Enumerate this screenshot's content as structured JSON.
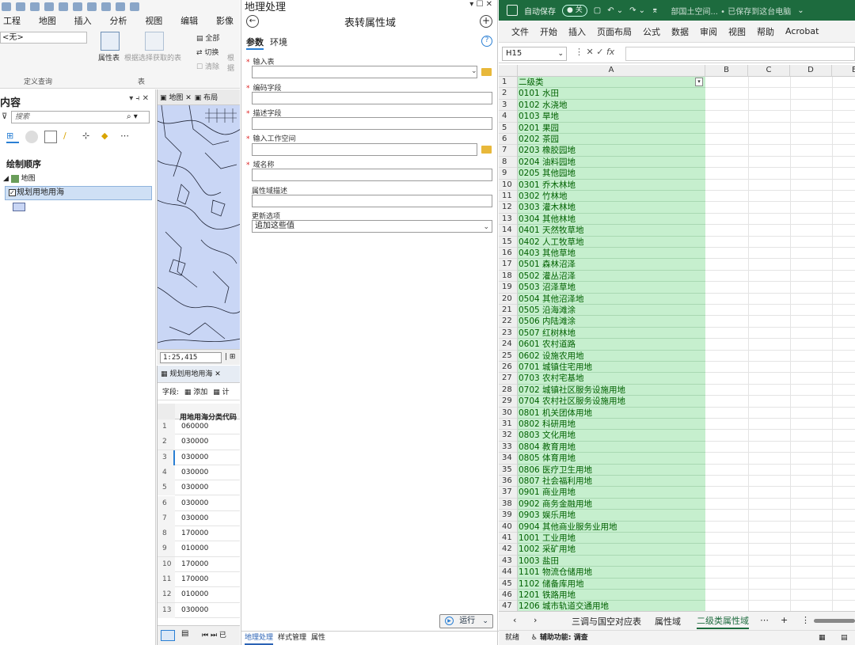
{
  "arcgis": {
    "ribbon_tabs": [
      "工程",
      "地图",
      "插入",
      "分析",
      "视图",
      "编辑",
      "影像"
    ],
    "definition_query_value": "<无>",
    "group_labels": {
      "definition_query": "定义查询",
      "table": "表"
    },
    "buttons": {
      "attribute_table": "属性表",
      "table_from_selection": "根据选择获取的表",
      "all": "全部",
      "switch": "切换",
      "clear": "清除",
      "basis": "根据"
    },
    "contents": {
      "title": "内容",
      "search_placeholder": "搜索",
      "draw_order": "绘制顺序",
      "map_item": "地图",
      "layer_item": "规划用地用海"
    },
    "map_tabs": [
      "地图",
      "布局"
    ],
    "scale": "1:25,415",
    "attribute_table": {
      "tab": "规划用地用海",
      "field_label": "字段:",
      "add_label": "添加",
      "calc_label": "计",
      "column_header": "用地用海分类代码",
      "rows": [
        {
          "n": "1",
          "v": "060000"
        },
        {
          "n": "2",
          "v": "030000"
        },
        {
          "n": "3",
          "v": "030000"
        },
        {
          "n": "4",
          "v": "030000"
        },
        {
          "n": "5",
          "v": "030000"
        },
        {
          "n": "6",
          "v": "030000"
        },
        {
          "n": "7",
          "v": "030000"
        },
        {
          "n": "8",
          "v": "170000"
        },
        {
          "n": "9",
          "v": "010000"
        },
        {
          "n": "10",
          "v": "170000"
        },
        {
          "n": "11",
          "v": "170000"
        },
        {
          "n": "12",
          "v": "010000"
        },
        {
          "n": "13",
          "v": "030000"
        }
      ]
    }
  },
  "geoprocessing": {
    "pane_title": "地理处理",
    "tool_title": "表转属性域",
    "tabs": [
      "参数",
      "环境"
    ],
    "params": [
      {
        "label": "输入表",
        "required": true,
        "value": ""
      },
      {
        "label": "编码字段",
        "required": true,
        "value": ""
      },
      {
        "label": "描述字段",
        "required": true,
        "value": ""
      },
      {
        "label": "输入工作空间",
        "required": true,
        "value": ""
      },
      {
        "label": "域名称",
        "required": true,
        "value": ""
      },
      {
        "label": "属性域描述",
        "required": false,
        "value": ""
      },
      {
        "label": "更新选项",
        "required": false,
        "value": "追加这些值"
      }
    ],
    "run_label": "运行",
    "footer_tabs": [
      "地理处理",
      "样式管理",
      "属性"
    ]
  },
  "excel": {
    "title_bar": {
      "autosave": "自动保存",
      "toggle": "关",
      "doc": "部国土空间...  •  已保存到这台电脑"
    },
    "menu": [
      "文件",
      "开始",
      "插入",
      "页面布局",
      "公式",
      "数据",
      "审阅",
      "视图",
      "帮助",
      "Acrobat"
    ],
    "name_box": "H15",
    "fx": "fx",
    "columns": [
      "A",
      "B",
      "C",
      "D",
      "E"
    ],
    "rows": [
      "二级类",
      "0101 水田",
      "0102 水浇地",
      "0103 旱地",
      "0201 果园",
      "0202 茶园",
      "0203 橡胶园地",
      "0204 油料园地",
      "0205 其他园地",
      "0301 乔木林地",
      "0302 竹林地",
      "0303 灌木林地",
      "0304 其他林地",
      "0401 天然牧草地",
      "0402 人工牧草地",
      "0403 其他草地",
      "0501 森林沼泽",
      "0502 灌丛沼泽",
      "0503 沼泽草地",
      "0504 其他沼泽地",
      "0505 沿海滩涂",
      "0506 内陆滩涂",
      "0507 红树林地",
      "0601 农村道路",
      "0602 设施农用地",
      "0701 城镇住宅用地",
      "0703 农村宅基地",
      "0702 城镇社区服务设施用地",
      "0704 农村社区服务设施用地",
      "0801 机关团体用地",
      "0802 科研用地",
      "0803 文化用地",
      "0804 教育用地",
      "0805 体育用地",
      "0806 医疗卫生用地",
      "0807 社会福利用地",
      "0901 商业用地",
      "0902 商务金融用地",
      "0903 娱乐用地",
      "0904 其他商业服务业用地",
      "1001 工业用地",
      "1002 采矿用地",
      "1003 盐田",
      "1101 物流仓储用地",
      "1102 储备库用地",
      "1201 铁路用地",
      "1206 城市轨道交通用地"
    ],
    "sheet_tabs": [
      "三调与国空对应表",
      "属性域",
      "二级类属性域"
    ],
    "status": {
      "ready": "就绪",
      "accessibility": "辅助功能: 调查"
    },
    "colors": {
      "title_bar": "#1d6b3e",
      "cell_fill": "#c6efce",
      "cell_text": "#006100"
    }
  }
}
